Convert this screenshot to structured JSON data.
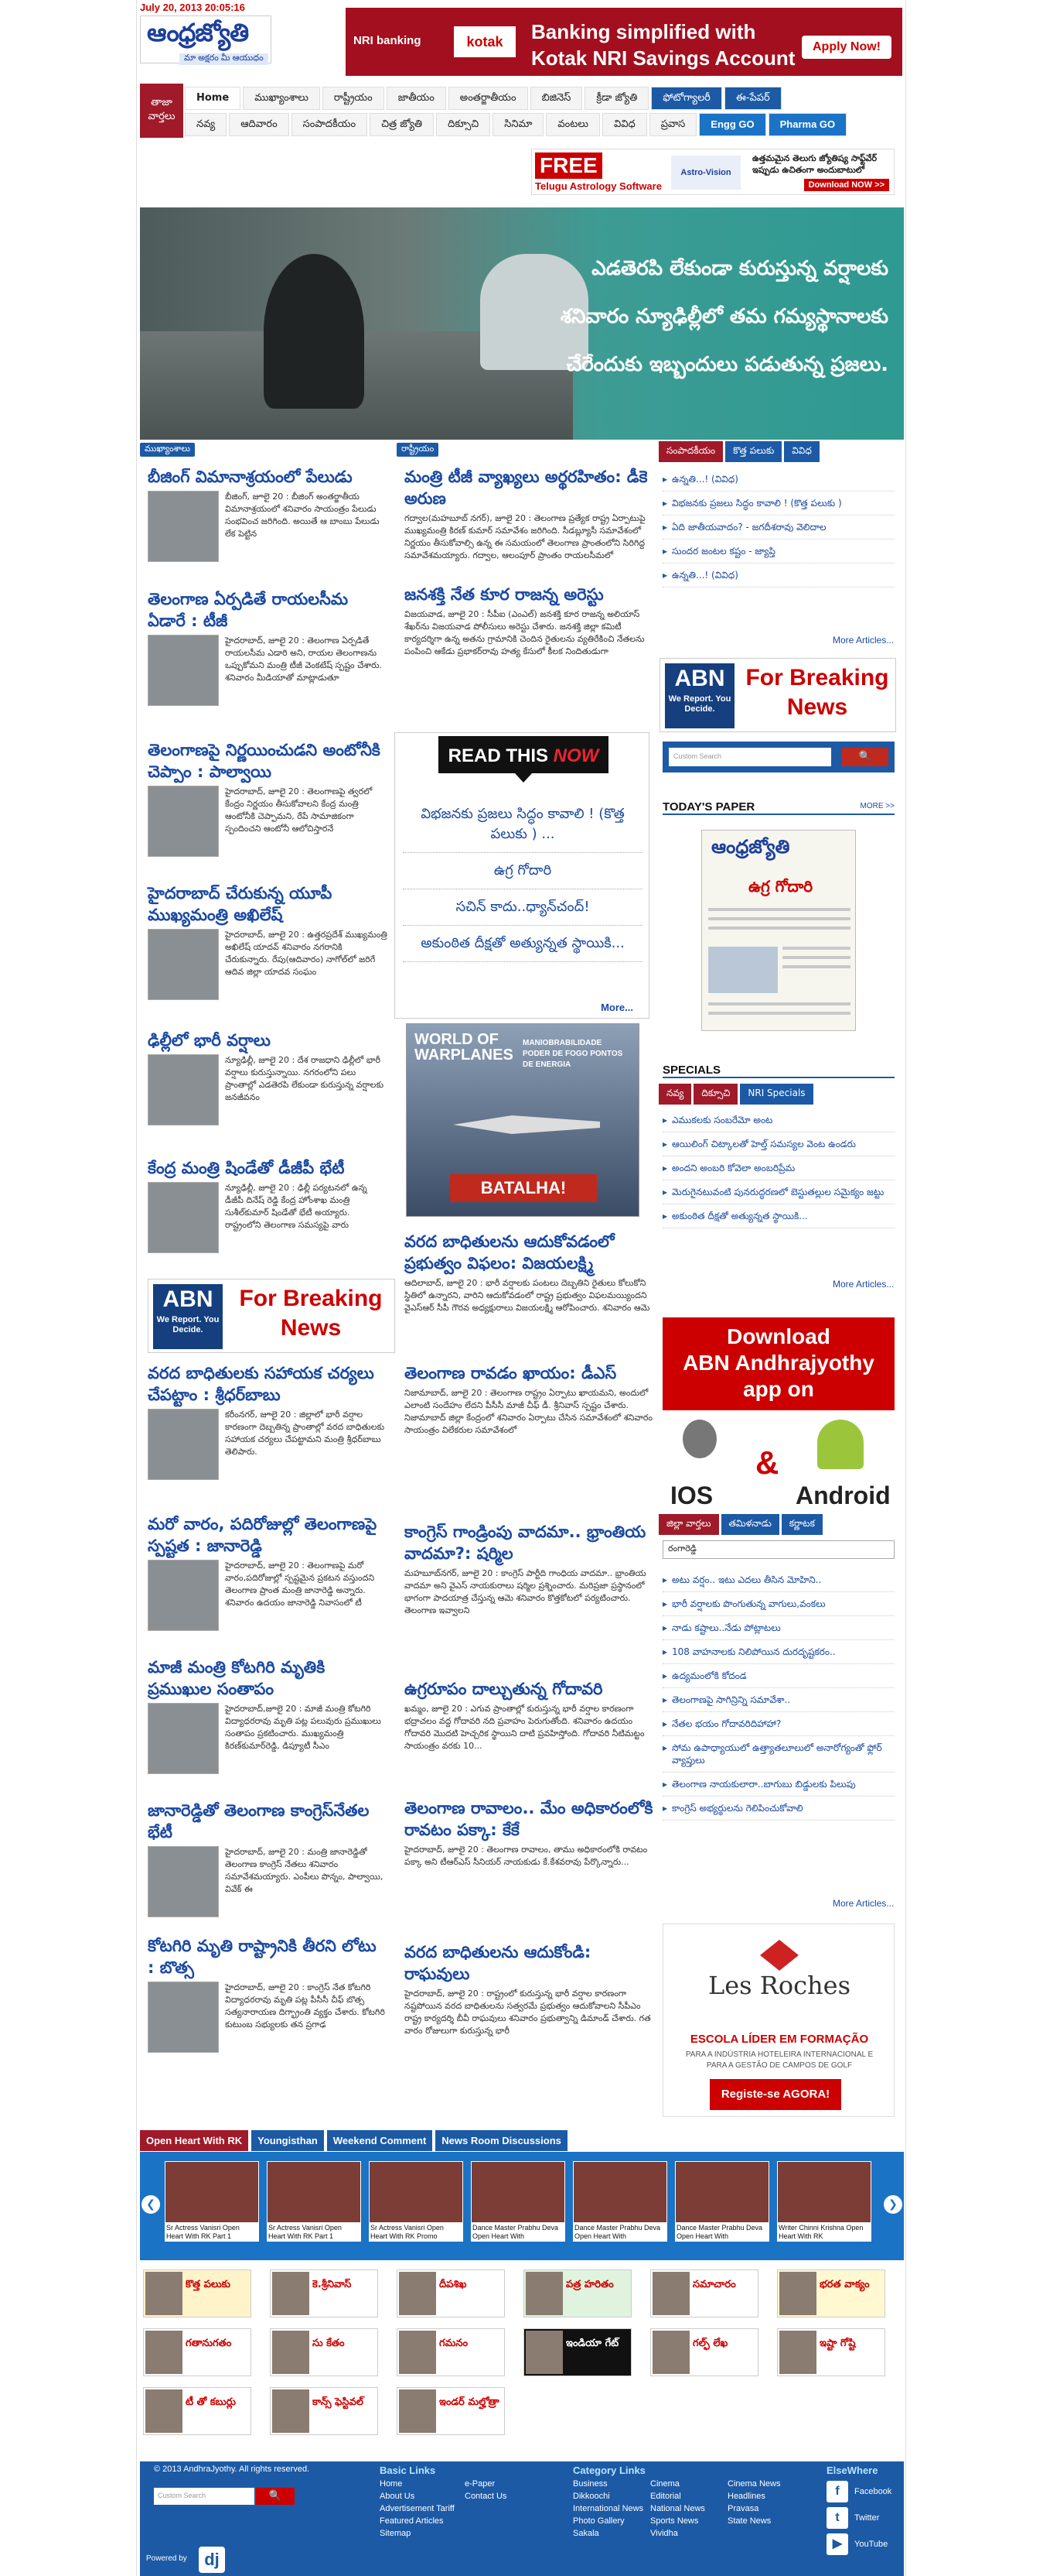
{
  "header": {
    "datetime": "July 20, 2013 20:05:16",
    "logo": "ఆంధ్రజ్యోతి",
    "tagline": "మా అక్షరం మీ ఆయుధం"
  },
  "top_ad": {
    "nri": "NRI banking",
    "bank": "kotak",
    "message_line1": "Banking simplified with",
    "message_line2": "Kotak NRI Savings Account",
    "cta": "Apply Now!"
  },
  "nav": {
    "label": "తాజా వార్తలు",
    "row1": [
      "Home",
      "ముఖ్యాంశాలు",
      "రాష్ట్రీయం",
      "జాతీయం",
      "అంతర్జాతీయం",
      "బిజినెస్",
      "క్రీడా జ్యోతి",
      "ఫోటోగ్యాలరీ",
      "ఈ-పేపర్"
    ],
    "row2": [
      "నవ్య",
      "ఆదివారం",
      "సంపాదకీయం",
      "చిత్ర జ్యోతి",
      "దిక్సూచి",
      "సినిమా",
      "వంటలు",
      "వివిధ",
      "ప్రవాస",
      "Engg GO",
      "Pharma GO"
    ]
  },
  "astro_ad": {
    "free": "FREE",
    "title": "Telugu Astrology Software",
    "brand": "Astro-Vision",
    "text": "ఉత్తమమైన తెలుగు జ్యోతిష్య సాఫ్ట్‌వేర్ ఇప్పుడు ఉచితంగా అందుబాటులో",
    "cta": "Download NOW >>"
  },
  "banner": {
    "caption_lines": [
      "ఎడతెరపి లేకుండా కురుస్తున్న వర్షాలకు",
      "శనివారం న్యూఢిల్లీలో తమ గమ్యస్థానాలకు",
      "చేరేందుకు ఇబ్బందులు పడుతున్న ప్రజలు."
    ]
  },
  "left_column": {
    "label": "ముఖ్యాంశాలు",
    "stories": [
      {
        "title": "బీజింగ్ విమానాశ్రయంలో పేలుడు",
        "body": "బీజింగ్, జూలై 20 : బీజింగ్ అంతర్జాతీయ విమానాశ్రయంలో శనివారం సాయంత్రం పేలుడు సంభవించ జరిగింది. అయితే ఆ బాంబు పేలుడు లేక పెట్టిన"
      },
      {
        "title": "తెలంగాణ ఏర్పడితే రాయలసీమ ఏడారే : టీజీ",
        "body": "హైదరాబాద్, జూలై 20 : తెలంగాణ ఏర్పడితే రాయలసీమ ఎడారి అని, రాయల తెలంగాణను ఒప్పుకోమని మంత్రి టీజీ వెంకటేష్ స్పష్టం చేశారు. శనివారం మీడియాతో మాట్లాడుతూ"
      },
      {
        "title": "తెలంగాణపై నిర్ణయించుడని అంటోనీకి చెప్పాం : పాల్వాయి",
        "body": "హైదరాబాద్, జూలై 20 : తెలంగాణపై త్వరలో కేంద్రం నిర్ణయం తీసుకోవాలని కేంద్ర మంత్రి ఆంటోనీకి చెప్పామని, రేపే సామాజికంగా స్పందించని ఆంటోనీ ఆలోచిస్తారనే"
      },
      {
        "title": "హైదరాబాద్ చేరుకున్న యూపీ ముఖ్యమంత్రి అఖిలేష్",
        "body": "హైదరాబాద్, జూలై 20 : ఉత్తరప్రదేశ్ ముఖ్యమంత్రి అఖిలేష్ యాదవ్ శనివారం నగరానికి చేరుకున్నారు. రేపు(ఆదివారం) నాగోల్‌లో జరిగే ఆదివ జిల్లా యాదవ సంఘం"
      },
      {
        "title": "ఢిల్లీలో భారీ వర్షాలు",
        "body": "న్యూఢిల్లీ, జూలై 20 : దేశ రాజధాని ఢిల్లీలో భారీ వర్షాలు కురుస్తున్నాయి. నగరంలోని పలు ప్రాంతాల్లో ఎడతెరపి లేకుండా కురుస్తున్న వర్షాలకు జనజీవనం"
      },
      {
        "title": "కేంద్ర మంత్రి షిండేతో డీజీపీ భేటీ",
        "body": "న్యూఢిల్లీ, జూలై 20 : ఢిల్లీ పర్యటనలో ఉన్న డీజీపీ దినేష్ రెడ్డి కేంద్ర హోంశాఖ మంత్రి సుశీల్‌కుమార్ షిండేతో భేటీ అయ్యారు. రాష్ట్రంలోని తెలంగాణ సమస్యపై వారు"
      },
      {
        "title": "వరద బాధితులకు సహాయక చర్యలు చేపట్టాం : శ్రీధర్‌బాబు",
        "body": "కరీంనగర్, జూలై 20 : జిల్లాలో భారీ వర్షాల కారణంగా దెబ్బతిన్న ప్రాంతాల్లో వరద బాధితులకు సహాయక చర్యలు చేపట్టామని మంత్రి శ్రీధర్‌బాబు తెలిపారు."
      },
      {
        "title": "మరో వారం, పదిరోజుల్లో తెలంగాణపై స్పష్టత : జానారెడ్డి",
        "body": "హైదరాబాద్, జూలై 20 : తెలంగాణపై మరో వారం,పదిరోజుల్లో స్పష్టమైన ప్రకటన వస్తుందని తెలంగాణ ప్రాంత మంత్రి జానారెడ్డి అన్నారు. శనివారం ఉదయం జానారెడ్డి నివాసంలో టీ"
      },
      {
        "title": "మాజీ మంత్రి కోటగిరి మృతికి ప్రముఖుల సంతాపం",
        "body": "హైదరాబాద్,జూలై 20 : మాజీ మంత్రి కోటగిరి విద్యాధరరావు మృతి పట్ల పలువురు ప్రముఖులు సంతాపం ప్రకటించారు. ముఖ్యమంత్రి కిరణ్‌కుమార్‌రెడ్డి, డిప్యూటీ సీఎం"
      },
      {
        "title": "జానారెడ్డితో తెలంగాణ కాంగ్రెస్‌నేతల భేటీ",
        "body": "హైదరాబాద్, జూలై 20 : మంత్రి జానారెడ్డితో తెలంగాణ కాంగ్రెస్ నేతలు శనివారం సమావేశమయ్యారు. ఎంపీలు పొన్నం, పాల్వాయి, వివేక్ ఈ"
      },
      {
        "title": "కోటగిరి మృతి రాష్ట్రానికి తీరని లోటు : బొత్స",
        "body": "హైదరాబాద్, జూలై 20 : కాంగ్రెస్ నేత కోటగిరి విద్యాధరరావు మృతి పట్ల పీసీసీ చీఫ్ బొత్స సత్యనారాయణ దిగ్భ్రాంతి వ్యక్తం చేశారు. కోటగిరి కుటుంబ సభ్యులకు తన ప్రగాఢ"
      }
    ]
  },
  "abn_ad": {
    "abn": "ABN",
    "tag": "We Report. You Decide.",
    "text": "For Breaking News"
  },
  "mid_column": {
    "label": "రాష్ట్రీయం",
    "stories_top": [
      {
        "title": "మంత్రి టీజీ వ్యాఖ్యలు అర్థరహితం: డీకె అరుణ",
        "body": "గద్వాల(మహబూబ్ నగర్), జూలై 20 : తెలంగాణ ప్రత్యేక రాష్ట్ర ఏర్పాటుపై ముఖ్యమంత్రి కిరణ్ కుమార్ సమావేశం జరిగింది. సీడబ్ల్యూసీ సమావేశంలో నిర్ణయం తీసుకోవాల్సి ఉన్న ఈ సమయంలో తెలంగాణ ప్రాంతంలోని సిరిగిద్ద సమావేశమయ్యారు. గద్వాల, ఆలంపూర్ ప్రాంతం రాయలసీమలో"
      },
      {
        "title": "జనశక్తి నేత కూర రాజన్న అరెస్టు",
        "body": "విజయవాడ, జూలై 20 : సీపీఐ (ఎంఎల్) జనశక్తి కూర రాజన్న అలియాస్ శేఖర్‌ను విజయవాడ పోలీసులు అరెస్టు చేశారు. జనశక్తి జిల్లా కమిటీ కార్యదర్శిగా ఉన్న అతను గ్రామానికి చెందిన రైతులను వ్యతిరేకించి నేతలను పంపించి ఆకేడు ప్రభాకర్‌రావు హత్య కేసులో కీలక నిందితుడుగా"
      }
    ],
    "stories_bottom": [
      {
        "title": "వరద బాధితులను ఆదుకోవడంలో ప్రభుత్వం విఫలం: విజయలక్ష్మి",
        "body": "ఆదిలాబాద్, జూలై 20 : భారీ వర్షాలకు పంటలు దెబ్బతిని రైతులు కోలుకోని స్థితిలో ఉన్నారని, వారిని ఆదుకోవడంలో రాష్ట్ర ప్రభుత్వం విఫలమయ్యిందని వైఎస్ఆర్ సీపీ గౌరవ అధ్యక్షురాలు విజయలక్ష్మి ఆరోపించారు. శనివారం ఆమె"
      },
      {
        "title": "తెలంగాణ రావడం ఖాయం: డీఎస్",
        "body": "నిజామాబాద్, జూలై 20 : తెలంగాణ రాష్ట్రం ఏర్పాటు ఖాయమని, అందులో ఎలాంటి సందేహం లేదని పీసీసీ మాజీ చీఫ్ డీ. శ్రీనివాస్ స్పష్టం చేశారు. నిజామాబాద్ జిల్లా కేంద్రంలో శనివారం ఏర్పాటు చేసిన సమావేశంలో శనివారం సాయంత్రం విలేకరుల సమావేశంలో"
      },
      {
        "title": "కాంగ్రెస్ గాండ్రింపు వాదమా.. భ్రాంతియ వాదమా?: షర్మిల",
        "body": "మహబూబ్‌నగర్, జూలై 20 : కాంగ్రెస్ పార్టీది గాంధియ వాదమా.. భ్రాంతియ వాదమా అని వైఎస్ నాయకురాలు షర్మిల ప్రశ్నించారు. మరిప్రజా ప్రస్థానంలో భాగంగా పాదయాత్ర చేస్తున్న ఆమె శనివారం కొత్తకోటలో పర్యటించారు. తెలంగాణ ఇవ్వాలని"
      },
      {
        "title": "ఉగ్రరూపం దాల్చుతున్న గోదావరి",
        "body": "ఖమ్మం, జూలై 20 : ఎగువ ప్రాంతాల్లో కురుస్తున్న భారీ వర్షాల కారణంగా భద్రాచలం వద్ద గోదావరి నది ప్రవాహం పెరుగుతోంది. శనివారం ఉదయం గోదావరి మొదటి హెచ్చరిక స్థాయిని దాటి ప్రవహిస్తోంది. గోదావరి నీటిమట్టం సాయంత్రం వరకు 10..."
      },
      {
        "title": "తెలంగాణ రావాలం.. మేం అధికారంలోకి రావటం పక్కా: కేకే",
        "body": "హైదరాబాద్, జూలై 20 : తెలంగాణ రావాలం, తాము అధికారంలోకి రావటం పక్కా అని టీఆర్ఎస్ సీనియర్ నాయకుడు కే.కేశవరావు పేర్కొన్నారు..."
      },
      {
        "title": "వరద బాధితులను ఆదుకోండి: రాఘవులు",
        "body": "హైదరాబాద్, జూలై 20 : రాష్ట్రంలో కురుస్తున్న భారీ వర్షాల కారణంగా నష్టపోయిన వరద బాధితులను సత్వరమే ప్రభుత్వం ఆదుకోవాలని సీపీఎం రాష్ట్ర కార్యదర్శి బీవీ రాఘవులు శనివారం ప్రభుత్వాన్ని డిమాండ్ చేశారు. గత వారం రోజులుగా కురుస్తున్న భారీ"
      }
    ]
  },
  "read_now": {
    "title_a": "READ THIS ",
    "title_b": "NOW",
    "items": [
      "విభజనకు ప్రజలు సిద్ధం కావాలి ! (కొత్త పలుకు ) ...",
      "ఉగ్ర గోదారి",
      "సచిన్ కాదు..ధ్యాన్‌చంద్!",
      "అకుంఠిత దీక్షతో అత్యున్నత స్థాయికి..."
    ],
    "more": "More..."
  },
  "game_ad": {
    "title": "WORLD OF WARPLANES",
    "tag": "MANIOBRABILIDADE PODER DE FOGO PONTOS DE ENERGIA",
    "cta": "BATALHA!"
  },
  "right_column": {
    "tabs": [
      "సంపాదకీయం",
      "కొత్త పలుకు",
      "వివిధ"
    ],
    "list1": [
      "ఉన్నతి...! (వివిధ)",
      "విభజనకు ప్రజలు సిద్ధం కావాలి ! (కొత్త పలుకు )",
      "ఏది జాతీయవాదం? - జగదీశరావు వెలిదాల",
      "సుందర జంటల కష్టం - జ్యాప్తి",
      "ఉన్నతి...! (వివిధ)"
    ],
    "more1": "More Articles...",
    "search_placeholder": "Custom Search",
    "todays_paper": "TODAY'S PAPER",
    "todays_more": "MORE >>",
    "paper_logo": "ఆంధ్రజ్యోతి",
    "paper_head": "ఉగ్ర గోదారి",
    "specials_title": "SPECIALS",
    "specials_tabs": [
      "నవ్య",
      "దిక్సూచి",
      "NRI Specials"
    ],
    "list2": [
      "ఎముకలకు సంబరేమో అంట",
      "ఆయిలింగ్ చిట్కాలతో హెల్త్ సమస్యల వెంట ఉండరు",
      "అందని అంబరి కోవెలా అంబరిప్రేమ",
      "మెరుగైనటువంటి పునరుద్ధరణలో బెస్టుతల్లుల సమైక్యం జట్టు",
      "అకుంఠిత దీక్షతో అత్యున్నత స్థాయికి..."
    ],
    "more2": "More Articles...",
    "app_line1": "Download",
    "app_line2": "ABN Andhrajyothy",
    "app_line3": "app on",
    "ios": "IOS",
    "amp": "&",
    "android": "Android",
    "district_tabs": [
      "జిల్లా వార్తలు",
      "తమిళనాడు",
      "కర్ణాటక"
    ],
    "district_select": "రంగారెడ్డి",
    "list3": [
      "అటు వర్షం.. ఇటు ఎదలు తీసిన మోహిని..",
      "భారీ వర్షాలకు పొంగుతున్న వాగులు,వంకలు",
      "నాడు కష్టాలు..నేడు పోట్లాటలు",
      "108 వాహనాలకు నిలిపోయిన దురదృష్టకరం..",
      "ఉద్యమంలోకి కోదండ",
      "తెలంగాణపై సాగిన్రిన్ని సమావేశా..",
      "నేతల భయం గోదావరిదిహాహా?",
      "సోమ ఉపాధ్యాయులో ఉత్త్యాతలూలులో అనారోగ్యంతో ఫ్లోర్ వ్యాప్తులు",
      "తెలంగాణ నాయకులారా..బాగుబు బిడ్డులకు పిలుపు",
      "కాంగ్రెస్ అభ్యర్థులను గెలిపించుకోవాలి"
    ],
    "more3": "More Articles...",
    "roches_logo": "Les Roches",
    "roches_sub": "ESCOLA LÍDER EM FORMAÇÃO",
    "roches_desc": "PARA A INDÚSTRIA HOTELEIRA INTERNACIONAL E PARA A GESTÃO DE CAMPOS DE GOLF",
    "roches_cta": "Registe-se AGORA!"
  },
  "video": {
    "tabs": [
      "Open Heart With RK",
      "Youngisthan",
      "Weekend Comment",
      "News Room Discussions"
    ],
    "items": [
      "Sr Actress Vanisri Open Heart With RK Part 1",
      "Sr Actress Vanisri Open Heart With RK Part 1",
      "Sr Actress Vanisri Open Heart With RK Promo",
      "Dance Master Prabhu Deva Open Heart With",
      "Dance Master Prabhu Deva Open Heart With",
      "Dance Master Prabhu Deva Open Heart With",
      "Writer Chinni Krishna Open Heart With RK"
    ]
  },
  "columns": [
    "కొత్త పలుకు",
    "కె.శ్రీనివాస్",
    "దీపశిఖ",
    "పత్ర హరితం",
    "సమాచారం",
    "భరత వాక్యం",
    "గతానుగతం",
    "సు కేతం",
    "గమనం",
    "ఇండియా గేట్",
    "గల్ఫ్ లేఖ",
    "ఇష్టా గోష్టి",
    "టీ తో కబుర్లు",
    "కాన్స్ ఫెస్టివల్",
    "ఇండర్ మల్హోత్రా"
  ],
  "footer": {
    "copyright": "© 2013 AndhraJyothy. All rights reserved.",
    "search_placeholder": "Custom Search",
    "powered": "Powered by",
    "basic_title": "Basic Links",
    "basic_links": [
      "Home",
      "e-Paper",
      "About Us",
      "Contact Us",
      "Advertisement Tariff",
      "",
      "Featured Articles",
      "",
      "Sitemap",
      ""
    ],
    "cat_title": "Category Links",
    "cat_links": [
      "Business",
      "Cinema",
      "Cinema News",
      "Dikkoochi",
      "Editorial",
      "Headlines",
      "International News",
      "National News",
      "Pravasa",
      "Photo Gallery",
      "Sports News",
      "State News",
      "Sakala",
      "Vividha",
      ""
    ],
    "else_title": "ElseWhere",
    "social": [
      "Facebook",
      "Twitter",
      "YouTube"
    ]
  }
}
